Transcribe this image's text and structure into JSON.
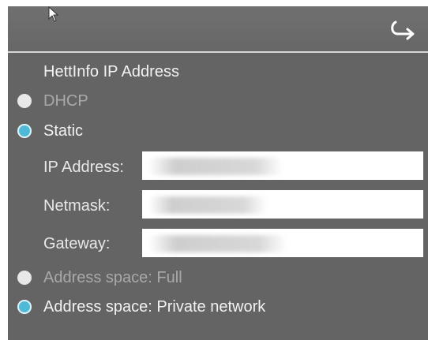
{
  "section_title": "HettInfo IP Address",
  "mode_options": [
    {
      "label": "DHCP",
      "checked": false
    },
    {
      "label": "Static",
      "checked": true
    }
  ],
  "fields": {
    "ip_address": {
      "label": "IP Address:",
      "value": ""
    },
    "netmask": {
      "label": "Netmask:",
      "value": ""
    },
    "gateway": {
      "label": "Gateway:",
      "value": ""
    }
  },
  "address_space_options": [
    {
      "label": "Address space: Full",
      "checked": false
    },
    {
      "label": "Address space: Private network",
      "checked": true
    }
  ],
  "header": {
    "back_icon": "return-arrow-icon"
  },
  "colors": {
    "panel_bg": "#646464",
    "accent_radio": "#4fb9d8",
    "unchecked_radio": "#e8e8e8"
  }
}
